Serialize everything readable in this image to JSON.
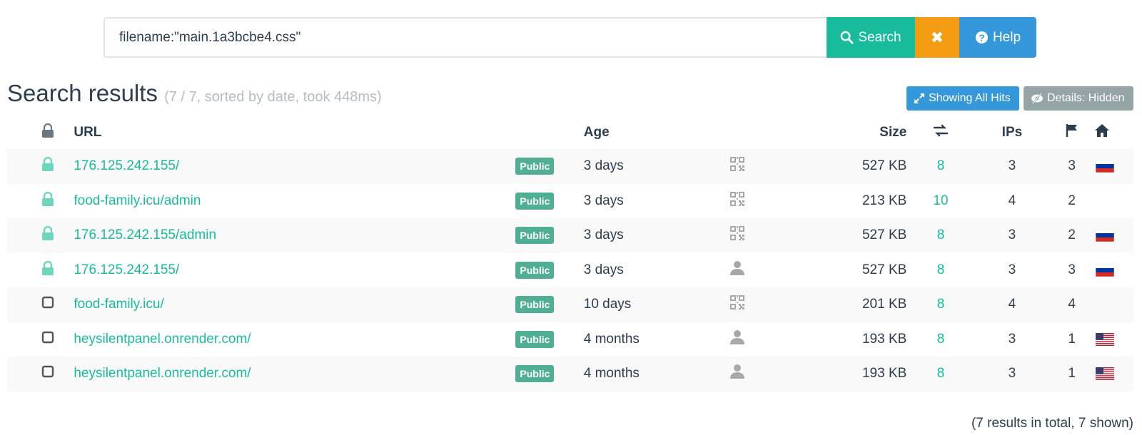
{
  "search": {
    "query": "filename:\"main.1a3bcbe4.css\"",
    "search_label": "Search",
    "clear_label": "✖",
    "help_label": "Help"
  },
  "results": {
    "title": "Search results",
    "subtitle": "(7 / 7, sorted by date, took 448ms)",
    "showing_all_hits_label": "Showing All Hits",
    "details_label": "Details: Hidden"
  },
  "table": {
    "headers": {
      "url": "URL",
      "age": "Age",
      "size": "Size",
      "ips": "IPs"
    },
    "rows": [
      {
        "secure": true,
        "url": "176.125.242.155/",
        "visibility": "Public",
        "age": "3 days",
        "thumb": "qr-icon",
        "size": "527 KB",
        "redirects": "8",
        "ips": "3",
        "countries": "3",
        "flag": "russia"
      },
      {
        "secure": true,
        "url": "food-family.icu/admin",
        "visibility": "Public",
        "age": "3 days",
        "thumb": "qr-icon",
        "size": "213 KB",
        "redirects": "10",
        "ips": "4",
        "countries": "2",
        "flag": ""
      },
      {
        "secure": true,
        "url": "176.125.242.155/admin",
        "visibility": "Public",
        "age": "3 days",
        "thumb": "qr-icon",
        "size": "527 KB",
        "redirects": "8",
        "ips": "3",
        "countries": "2",
        "flag": "russia"
      },
      {
        "secure": true,
        "url": "176.125.242.155/",
        "visibility": "Public",
        "age": "3 days",
        "thumb": "user-icon",
        "size": "527 KB",
        "redirects": "8",
        "ips": "3",
        "countries": "3",
        "flag": "russia"
      },
      {
        "secure": false,
        "url": "food-family.icu/",
        "visibility": "Public",
        "age": "10 days",
        "thumb": "qr-icon",
        "size": "201 KB",
        "redirects": "8",
        "ips": "4",
        "countries": "4",
        "flag": ""
      },
      {
        "secure": false,
        "url": "heysilentpanel.onrender.com/",
        "visibility": "Public",
        "age": "4 months",
        "thumb": "user-icon",
        "size": "193 KB",
        "redirects": "8",
        "ips": "3",
        "countries": "1",
        "flag": "usa"
      },
      {
        "secure": false,
        "url": "heysilentpanel.onrender.com/",
        "visibility": "Public",
        "age": "4 months",
        "thumb": "user-icon",
        "size": "193 KB",
        "redirects": "8",
        "ips": "3",
        "countries": "1",
        "flag": "usa"
      }
    ]
  },
  "footer": {
    "total": "(7 results in total, 7 shown)"
  },
  "colors": {
    "accent": "#18bc9c",
    "warning": "#f39c12",
    "info": "#3498db",
    "muted": "#95a5a6",
    "badge": "#4fae93"
  }
}
